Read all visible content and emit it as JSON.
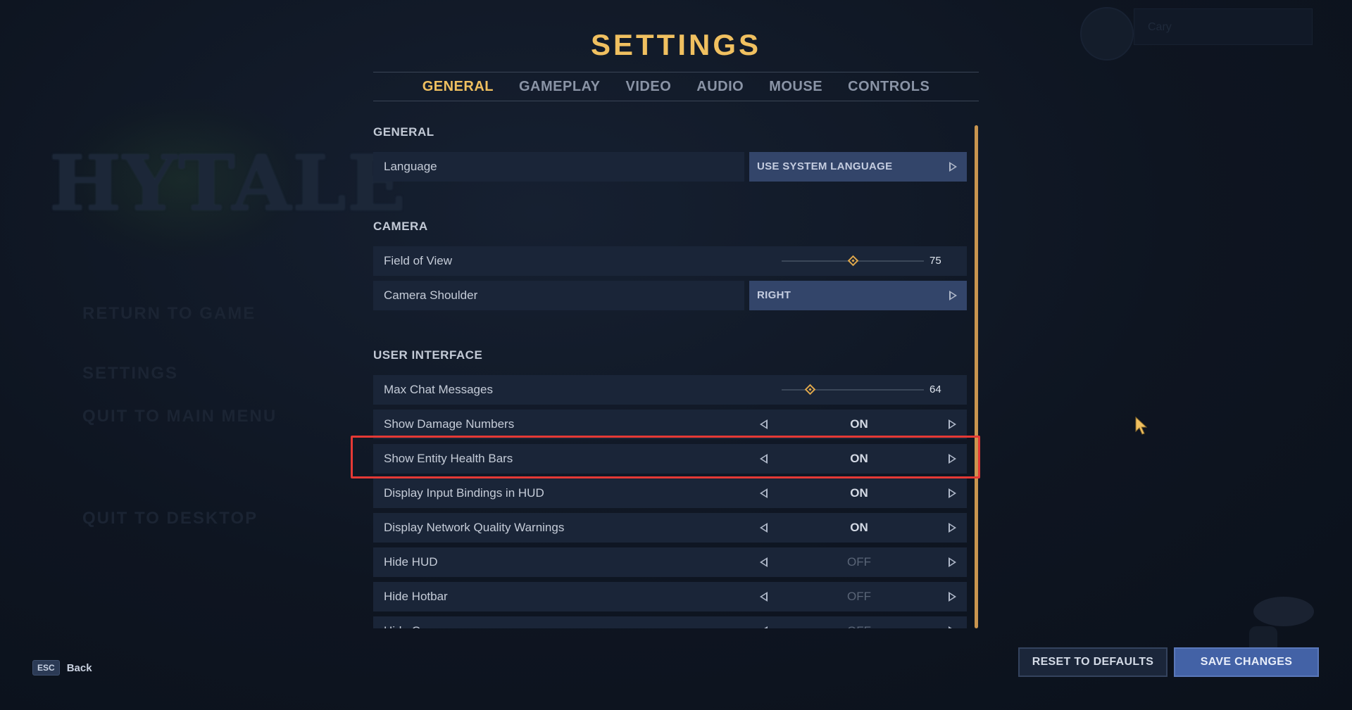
{
  "background": {
    "logo_text": "HYTALE",
    "menu": [
      "RETURN TO GAME",
      "SETTINGS",
      "QUIT TO MAIN MENU",
      "QUIT TO DESKTOP"
    ],
    "username": "Cary"
  },
  "title": "SETTINGS",
  "tabs": [
    {
      "label": "GENERAL",
      "active": true
    },
    {
      "label": "GAMEPLAY",
      "active": false
    },
    {
      "label": "VIDEO",
      "active": false
    },
    {
      "label": "AUDIO",
      "active": false
    },
    {
      "label": "MOUSE",
      "active": false
    },
    {
      "label": "CONTROLS",
      "active": false
    }
  ],
  "sections": {
    "general": "GENERAL",
    "camera": "CAMERA",
    "ui": "USER INTERFACE"
  },
  "settings": {
    "language": {
      "label": "Language",
      "value": "USE SYSTEM LANGUAGE"
    },
    "fov": {
      "label": "Field of View",
      "value": "75",
      "level": 0.5
    },
    "camera_shoulder": {
      "label": "Camera Shoulder",
      "value": "RIGHT"
    },
    "max_chat": {
      "label": "Max Chat Messages",
      "value": "64",
      "level": 0.2
    },
    "toggles": [
      {
        "label": "Show Damage Numbers",
        "value": "ON"
      },
      {
        "label": "Show Entity Health Bars",
        "value": "ON"
      },
      {
        "label": "Display Input Bindings in HUD",
        "value": "ON"
      },
      {
        "label": "Display Network Quality Warnings",
        "value": "ON"
      },
      {
        "label": "Hide HUD",
        "value": "OFF"
      },
      {
        "label": "Hide Hotbar",
        "value": "OFF"
      },
      {
        "label": "Hide C",
        "value": "OFF"
      }
    ]
  },
  "footer": {
    "esc_key": "ESC",
    "back_label": "Back",
    "reset_label": "RESET TO DEFAULTS",
    "save_label": "SAVE CHANGES"
  },
  "colors": {
    "accent": "#f0c060",
    "highlight": "#e53935",
    "save_button": "#4362a6"
  }
}
